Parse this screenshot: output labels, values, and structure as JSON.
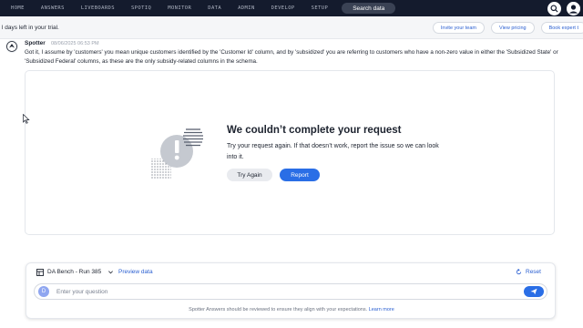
{
  "topnav": {
    "items": [
      "HOME",
      "ANSWERS",
      "LIVEBOARDS",
      "SPOTIQ",
      "MONITOR",
      "DATA",
      "ADMIN",
      "DEVELOP",
      "SETUP"
    ],
    "search_label": "Search data"
  },
  "trial": {
    "text": "l days left in your trial.",
    "buttons": [
      "Invite your team",
      "View pricing",
      "Book expert t"
    ]
  },
  "message": {
    "author": "Spotter",
    "timestamp": "08/06/2025 06:53 PM",
    "text": "Got it, I assume by 'customers' you mean unique customers identified by the 'Customer Id' column, and by 'subsidized' you are referring to customers who have a non-zero value in either the 'Subsidized State' or 'Subsidized Federal' columns, as these are the only subsidy-related columns in the schema."
  },
  "error": {
    "title": "We couldn’t complete your request",
    "body": "Try your request again. If that doesn’t work, report the issue so we can look into it.",
    "try_again_label": "Try Again",
    "report_label": "Report"
  },
  "bottom": {
    "datasource": "DA Bench - Run 385",
    "preview_label": "Preview data",
    "reset_label": "Reset",
    "avatar_letter": "D",
    "input_placeholder": "Enter your question",
    "disclaimer": "Spotter Answers should be reviewed to ensure they align with your expectations.",
    "learn_more": "Learn more"
  },
  "colors": {
    "nav_bg": "#141b2d",
    "accent": "#2a6ee6",
    "link": "#2a5fd1"
  },
  "icons": [
    "search-icon",
    "user-avatar-icon",
    "spotter-icon",
    "error-illustration",
    "table-icon",
    "chevron-down-icon",
    "reset-icon",
    "send-icon",
    "cursor-icon"
  ]
}
